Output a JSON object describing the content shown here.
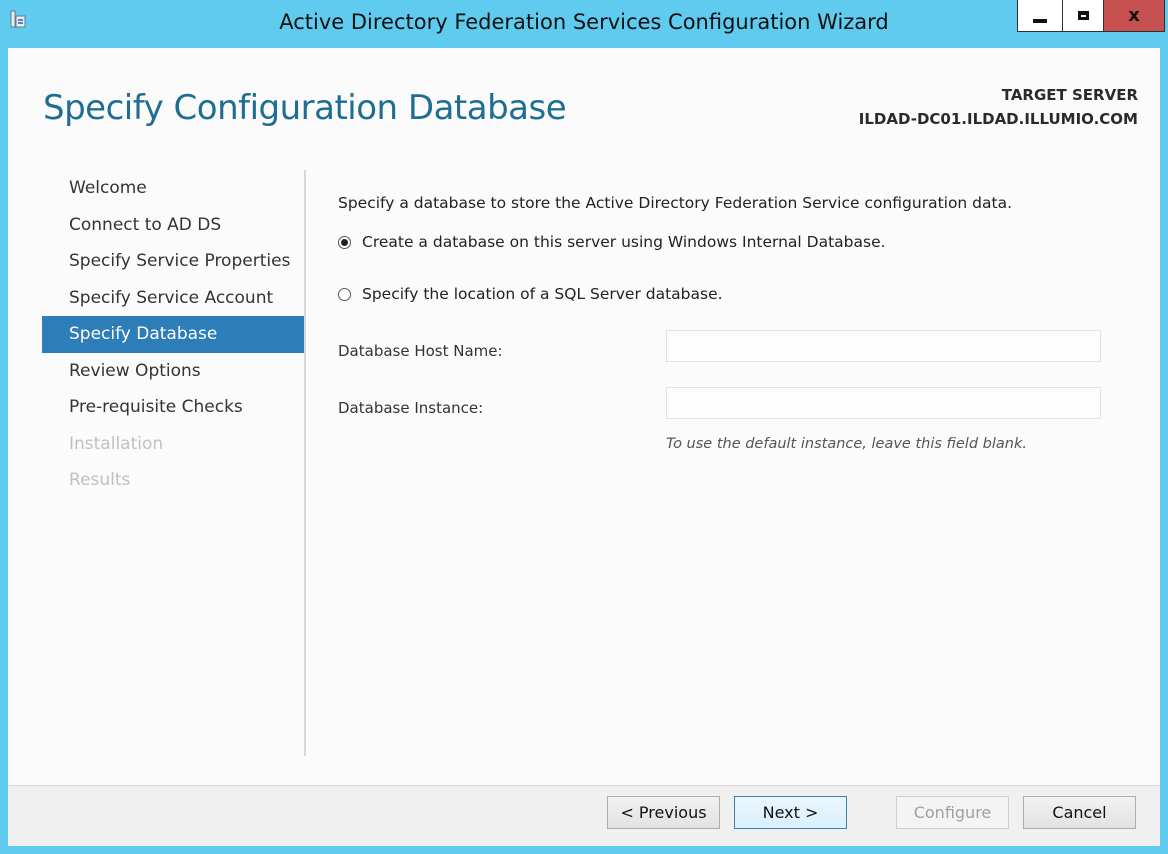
{
  "window": {
    "title": "Active Directory Federation Services Configuration Wizard",
    "close_label": "x"
  },
  "header": {
    "page_title": "Specify Configuration Database",
    "target_label": "TARGET SERVER",
    "target_name": "ILDAD-DC01.ILDAD.ILLUMIO.COM"
  },
  "nav": {
    "items": [
      {
        "label": "Welcome",
        "state": "normal"
      },
      {
        "label": "Connect to AD DS",
        "state": "normal"
      },
      {
        "label": "Specify Service Properties",
        "state": "normal"
      },
      {
        "label": "Specify Service Account",
        "state": "normal"
      },
      {
        "label": "Specify Database",
        "state": "active"
      },
      {
        "label": "Review Options",
        "state": "normal"
      },
      {
        "label": "Pre-requisite Checks",
        "state": "normal"
      },
      {
        "label": "Installation",
        "state": "disabled"
      },
      {
        "label": "Results",
        "state": "disabled"
      }
    ]
  },
  "content": {
    "description": "Specify a database to store the Active Directory Federation Service configuration data.",
    "option_wid_label": "Create a database on this server using Windows Internal Database.",
    "option_wid_selected": true,
    "option_sql_label": "Specify the location of a SQL Server database.",
    "option_sql_selected": false,
    "host_label": "Database Host Name:",
    "host_value": "",
    "instance_label": "Database Instance:",
    "instance_value": "",
    "instance_hint": "To use the default instance, leave this field blank."
  },
  "footer": {
    "previous_label": "< Previous",
    "next_label": "Next >",
    "configure_label": "Configure",
    "cancel_label": "Cancel"
  },
  "colors": {
    "titlebar": "#5ecbef",
    "accent": "#2d7db9",
    "title_text": "#1f6e91",
    "close_button": "#c75050"
  }
}
